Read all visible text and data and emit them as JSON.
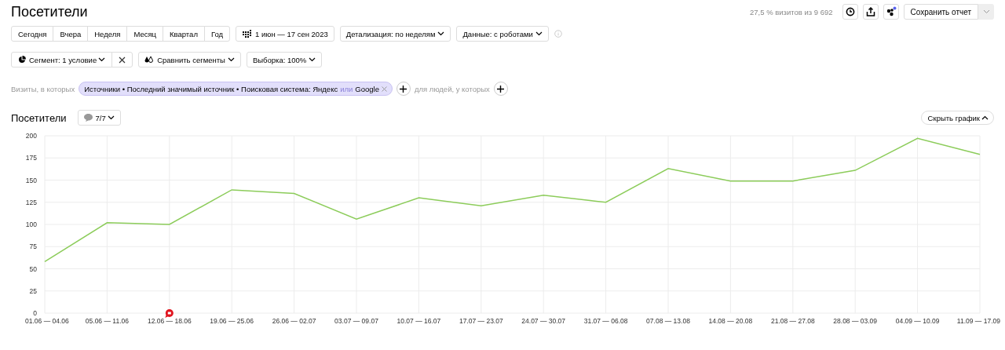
{
  "title": "Посетители",
  "sample_info": "27,5 % визитов из 9 692",
  "save_button": "Сохранить отчет",
  "periods": [
    {
      "label": "Сегодня",
      "selected": false
    },
    {
      "label": "Вчера",
      "selected": false
    },
    {
      "label": "Неделя",
      "selected": false
    },
    {
      "label": "Месяц",
      "selected": false
    },
    {
      "label": "Квартал",
      "selected": false
    },
    {
      "label": "Год",
      "selected": false
    }
  ],
  "date_range": "1 июн — 17 сен 2023",
  "detail_dropdown": "Детализация: по неделям",
  "data_dropdown": "Данные: с роботами",
  "segment_dropdown": "Сегмент: 1 условие",
  "compare_button": "Сравнить сегменты",
  "sample_dropdown": "Выборка: 100%",
  "filter": {
    "prefix": "Визиты, в которых",
    "chip_source": "Источники • Последний значимый источник • Поисковая система: Яндекс",
    "chip_connector": "или",
    "chip_value": "Google",
    "people_label": "для людей, у которых"
  },
  "chart_section": {
    "title": "Посетители",
    "notes_button": "7/7",
    "hide_button": "Скрыть график",
    "chart_data": {
      "type": "line",
      "categories": [
        "01.06 — 04.06",
        "05.06 — 11.06",
        "12.06 — 18.06",
        "19.06 — 25.06",
        "26.06 — 02.07",
        "03.07 — 09.07",
        "10.07 — 16.07",
        "17.07 — 23.07",
        "24.07 — 30.07",
        "31.07 — 06.08",
        "07.08 — 13.08",
        "14.08 — 20.08",
        "21.08 — 27.08",
        "28.08 — 03.09",
        "04.09 — 10.09",
        "11.09 — 17.09"
      ],
      "grid": true,
      "series": [
        {
          "color": "#8ccc5a",
          "values": [
            58,
            102,
            100,
            139,
            135,
            106,
            130,
            121,
            133,
            125,
            163,
            149,
            149,
            161,
            197,
            179
          ]
        }
      ],
      "ylim": [
        0,
        200
      ],
      "yticks": [
        0,
        25,
        50,
        75,
        100,
        125,
        150,
        175,
        200
      ]
    }
  }
}
